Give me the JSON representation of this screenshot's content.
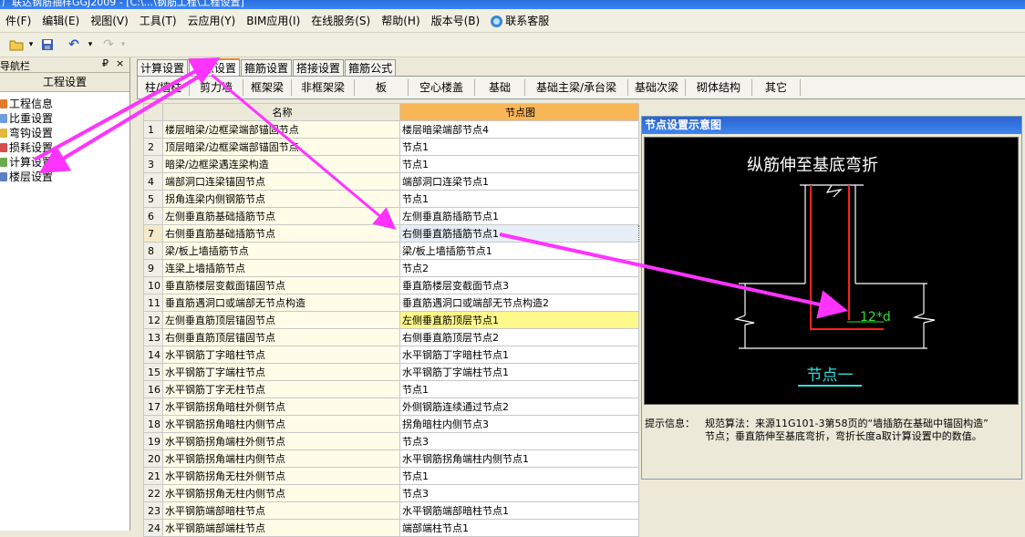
{
  "window_title": "广联达钢筋抽样GGJ2009 - [C:\\...\\钢筋工程\\工程设置]",
  "menu": [
    "件(F)",
    "编辑(E)",
    "视图(V)",
    "工具(T)",
    "云应用(Y)",
    "BIM应用(I)",
    "在线服务(S)",
    "帮助(H)",
    "版本号(B)",
    "联系客服"
  ],
  "nav": {
    "header": "导航栏",
    "pin": "₽",
    "close": "×",
    "section": "工程设置",
    "items": [
      "工程信息",
      "比重设置",
      "弯钩设置",
      "损耗设置",
      "计算设置",
      "楼层设置"
    ]
  },
  "tabs": [
    "计算设置",
    "节点设置",
    "箍筋设置",
    "搭接设置",
    "箍筋公式"
  ],
  "subtabs": [
    "柱/墙柱",
    "剪力墙",
    "框架梁",
    "非框架梁",
    "板",
    "空心楼盖",
    "基础",
    "基础主梁/承台梁",
    "基础次梁",
    "砌体结构",
    "其它"
  ],
  "grid": {
    "headers": [
      "",
      "名称",
      "节点图"
    ],
    "rows": [
      [
        "1",
        "楼层暗梁/边框梁端部锚固节点",
        "楼层暗梁端部节点4"
      ],
      [
        "2",
        "顶层暗梁/边框梁端部锚固节点",
        "节点1"
      ],
      [
        "3",
        "暗梁/边框梁遇连梁构造",
        "节点1"
      ],
      [
        "4",
        "端部洞口连梁锚固节点",
        "端部洞口连梁节点1"
      ],
      [
        "5",
        "拐角连梁内侧钢筋节点",
        "节点1"
      ],
      [
        "6",
        "左侧垂直筋基础插筋节点",
        "左侧垂直筋插筋节点1"
      ],
      [
        "7",
        "右侧垂直筋基础插筋节点",
        "右侧垂直筋插筋节点1"
      ],
      [
        "8",
        "梁/板上墙插筋节点",
        "梁/板上墙插筋节点1"
      ],
      [
        "9",
        "连梁上墙插筋节点",
        "节点2"
      ],
      [
        "10",
        "垂直筋楼层变截面锚固节点",
        "垂直筋楼层变截面节点3"
      ],
      [
        "11",
        "垂直筋遇洞口或端部无节点构造",
        "垂直筋遇洞口或端部无节点构造2"
      ],
      [
        "12",
        "左侧垂直筋顶层锚固节点",
        "左侧垂直筋顶层节点1"
      ],
      [
        "13",
        "右侧垂直筋顶层锚固节点",
        "右侧垂直筋顶层节点2"
      ],
      [
        "14",
        "水平钢筋丁字暗柱节点",
        "水平钢筋丁字暗柱节点1"
      ],
      [
        "15",
        "水平钢筋丁字端柱节点",
        "水平钢筋丁字端柱节点1"
      ],
      [
        "16",
        "水平钢筋丁字无柱节点",
        "节点1"
      ],
      [
        "17",
        "水平钢筋拐角暗柱外侧节点",
        "外侧钢筋连续通过节点2"
      ],
      [
        "18",
        "水平钢筋拐角暗柱内侧节点",
        "拐角暗柱内侧节点3"
      ],
      [
        "19",
        "水平钢筋拐角端柱外侧节点",
        "节点3"
      ],
      [
        "20",
        "水平钢筋拐角端柱内侧节点",
        "水平钢筋拐角端柱内侧节点1"
      ],
      [
        "21",
        "水平钢筋拐角无柱外侧节点",
        "节点1"
      ],
      [
        "22",
        "水平钢筋拐角无柱内侧节点",
        "节点3"
      ],
      [
        "23",
        "水平钢筋端部暗柱节点",
        "水平钢筋端部暗柱节点1"
      ],
      [
        "24",
        "水平钢筋端部端柱节点",
        "端部端柱节点1"
      ]
    ]
  },
  "diagram": {
    "title": "节点设置示意图",
    "caption": "纵筋伸至基底弯折",
    "dim_label": "12*d",
    "node_label": "节点一",
    "colors": {
      "wall": "#ffffff",
      "rebar": "#ff2020",
      "dim": "#33dd33",
      "node": "#33dddd"
    }
  },
  "hint": {
    "label": "提示信息：",
    "text": "规范算法：来源11G101-3第58页的“墙插筋在基础中锚固构造”\n节点；垂直筋伸至基底弯折，弯折长度a取计算设置中的数值。"
  },
  "annotation_color": "#ff33ff"
}
